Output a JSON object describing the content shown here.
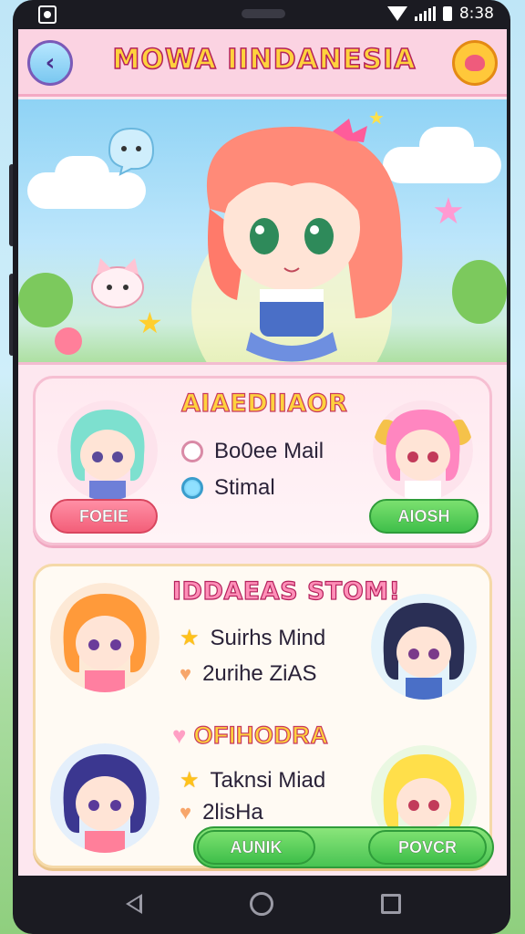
{
  "status_bar": {
    "time": "8:38"
  },
  "header": {
    "title": "MOWA IINDANESIA"
  },
  "card_top": {
    "title": "AIAEDIIAOR",
    "options": [
      {
        "label": "Bo0ee Mail",
        "selected": false
      },
      {
        "label": "Stimal",
        "selected": true
      }
    ],
    "left_button": "FOEIE",
    "right_button": "AIOSH"
  },
  "card_bottom": {
    "section1": {
      "title": "IDDAEAS STOM!",
      "items": [
        {
          "icon": "star-icon",
          "label": "Suirhs Mind"
        },
        {
          "icon": "heart-icon",
          "label": "2urihe ZiAS"
        }
      ]
    },
    "section2": {
      "title": "OFIHODRA",
      "items": [
        {
          "icon": "star-icon",
          "label": "Taknsi Miad"
        },
        {
          "icon": "heart-icon",
          "label": "2lisHa"
        }
      ]
    },
    "left_button": "AUNIK",
    "right_button": "POVCR"
  },
  "colors": {
    "header_bg": "#fbd3e2",
    "title_yellow": "#ffd23d",
    "green_button": "#3fbf4a",
    "red_button": "#f35f79"
  }
}
